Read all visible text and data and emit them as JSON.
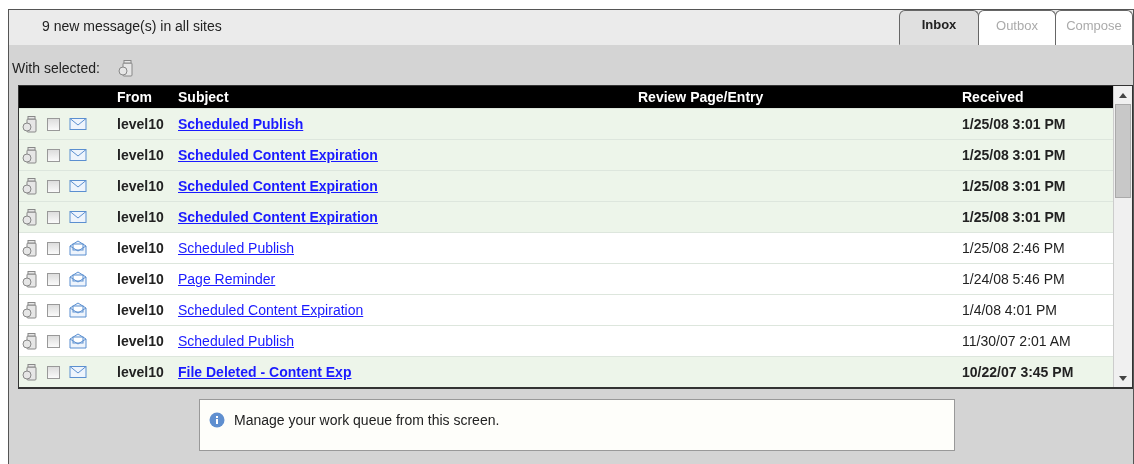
{
  "header": {
    "summary": "9 new message(s) in all sites"
  },
  "tabs": [
    {
      "label": "Inbox",
      "selected": true
    },
    {
      "label": "Outbox",
      "selected": false
    },
    {
      "label": "Compose",
      "selected": false
    }
  ],
  "toolbar": {
    "label": "With selected:"
  },
  "table": {
    "columns": [
      "From",
      "Subject",
      "Review Page/Entry",
      "Received"
    ],
    "rows": [
      {
        "checked": false,
        "unread": true,
        "from": "level10",
        "subject": "Scheduled Publish",
        "received": "1/25/08 3:01 PM"
      },
      {
        "checked": false,
        "unread": true,
        "from": "level10",
        "subject": "Scheduled Content Expiration",
        "received": "1/25/08 3:01 PM"
      },
      {
        "checked": false,
        "unread": true,
        "from": "level10",
        "subject": "Scheduled Content Expiration",
        "received": "1/25/08 3:01 PM"
      },
      {
        "checked": false,
        "unread": true,
        "from": "level10",
        "subject": "Scheduled Content Expiration",
        "received": "1/25/08 3:01 PM"
      },
      {
        "checked": false,
        "unread": false,
        "from": "level10",
        "subject": "Scheduled Publish",
        "received": "1/25/08 2:46 PM"
      },
      {
        "checked": false,
        "unread": false,
        "from": "level10",
        "subject": "Page Reminder",
        "received": "1/24/08 5:46 PM"
      },
      {
        "checked": false,
        "unread": false,
        "from": "level10",
        "subject": "Scheduled Content Expiration",
        "received": "1/4/08 4:01 PM"
      },
      {
        "checked": false,
        "unread": false,
        "from": "level10",
        "subject": "Scheduled Publish",
        "received": "11/30/07 2:01 AM"
      },
      {
        "checked": false,
        "unread": true,
        "from": "level10",
        "subject": "File Deleted - Content Exp",
        "received": "10/22/07 3:45 PM"
      }
    ]
  },
  "info": {
    "message": "Manage your work queue from this screen."
  }
}
